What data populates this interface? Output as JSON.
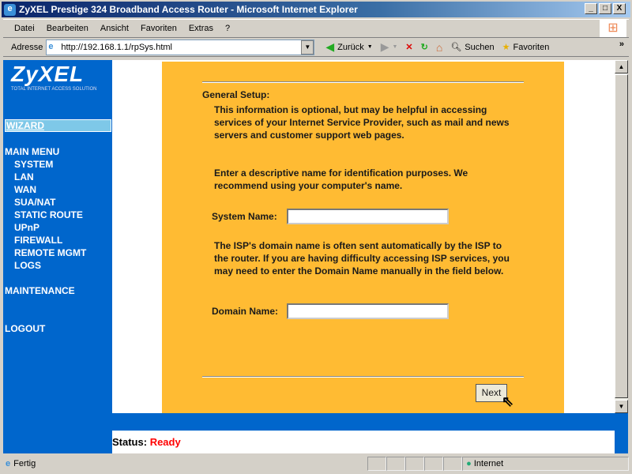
{
  "window": {
    "title": "ZyXEL Prestige 324 Broadband Access Router - Microsoft Internet Explorer",
    "min": "_",
    "max": "□",
    "close": "X"
  },
  "menu": [
    "Datei",
    "Bearbeiten",
    "Ansicht",
    "Favoriten",
    "Extras",
    "?"
  ],
  "address": {
    "label": "Adresse",
    "url": "http://192.168.1.1/rpSys.html"
  },
  "toolbar": {
    "back": "Zurück",
    "search": "Suchen",
    "favorites": "Favoriten",
    "more": "»"
  },
  "logo": {
    "name": "ZyXEL",
    "tagline": "Total Internet Access Solution"
  },
  "nav": {
    "wizard": "WIZARD",
    "main_menu": "MAIN MENU",
    "items": [
      "SYSTEM",
      "LAN",
      "WAN",
      "SUA/NAT",
      "STATIC ROUTE",
      "UPnP",
      "FIREWALL",
      "REMOTE MGMT",
      "LOGS"
    ],
    "maintenance": "MAINTENANCE",
    "logout": "LOGOUT"
  },
  "form": {
    "heading": "General Setup:",
    "intro": "This information is optional, but may be helpful in accessing services of your Internet Service Provider, such as mail and news servers and customer support web pages.",
    "name_hint": "Enter a descriptive name for identification purposes. We recommend using your computer's name.",
    "system_name_label": "System Name:",
    "system_name_value": "",
    "domain_hint": "The ISP's domain name is often sent automatically by the ISP to the router. If you are having difficulty accessing ISP services, you may need to enter the Domain Name manually in the field below.",
    "domain_name_label": "Domain Name:",
    "domain_name_value": "",
    "next": "Next"
  },
  "status": {
    "label": "Status:",
    "value": "Ready",
    "value_color": "#ff0000"
  },
  "statusbar": {
    "text": "Fertig",
    "zone": "Internet"
  }
}
